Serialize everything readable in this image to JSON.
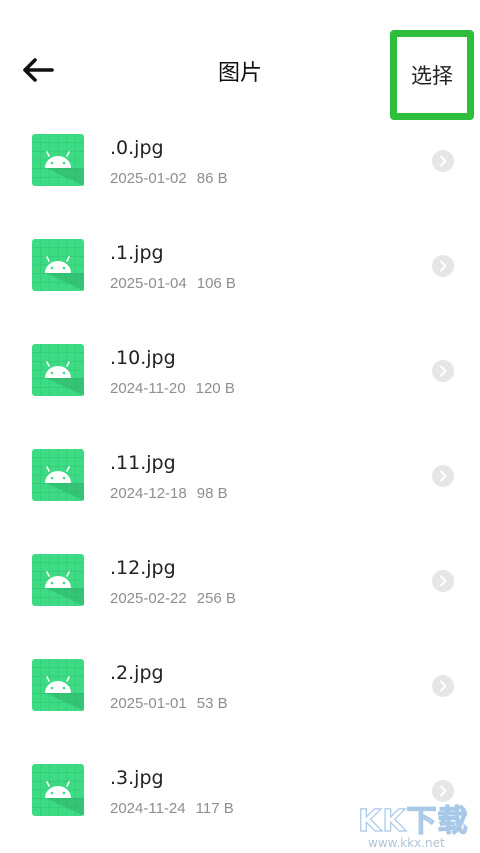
{
  "header": {
    "title": "图片",
    "select_label": "选择",
    "back_icon": "arrow-left-icon"
  },
  "files": [
    {
      "name": ".0.jpg",
      "date": "2025-01-02",
      "size": "86 B"
    },
    {
      "name": ".1.jpg",
      "date": "2025-01-04",
      "size": "106 B"
    },
    {
      "name": ".10.jpg",
      "date": "2024-11-20",
      "size": "120 B"
    },
    {
      "name": ".11.jpg",
      "date": "2024-12-18",
      "size": "98 B"
    },
    {
      "name": ".12.jpg",
      "date": "2025-02-22",
      "size": "256 B"
    },
    {
      "name": ".2.jpg",
      "date": "2025-01-01",
      "size": "53 B"
    },
    {
      "name": ".3.jpg",
      "date": "2024-11-24",
      "size": "117 B"
    }
  ],
  "watermark": {
    "brand": "KK下载",
    "url": "www.kkx.net"
  },
  "colors": {
    "accent_border": "#2fbe3c",
    "thumb_green": "#3ddc84",
    "meta_gray": "#8e8e8e"
  }
}
